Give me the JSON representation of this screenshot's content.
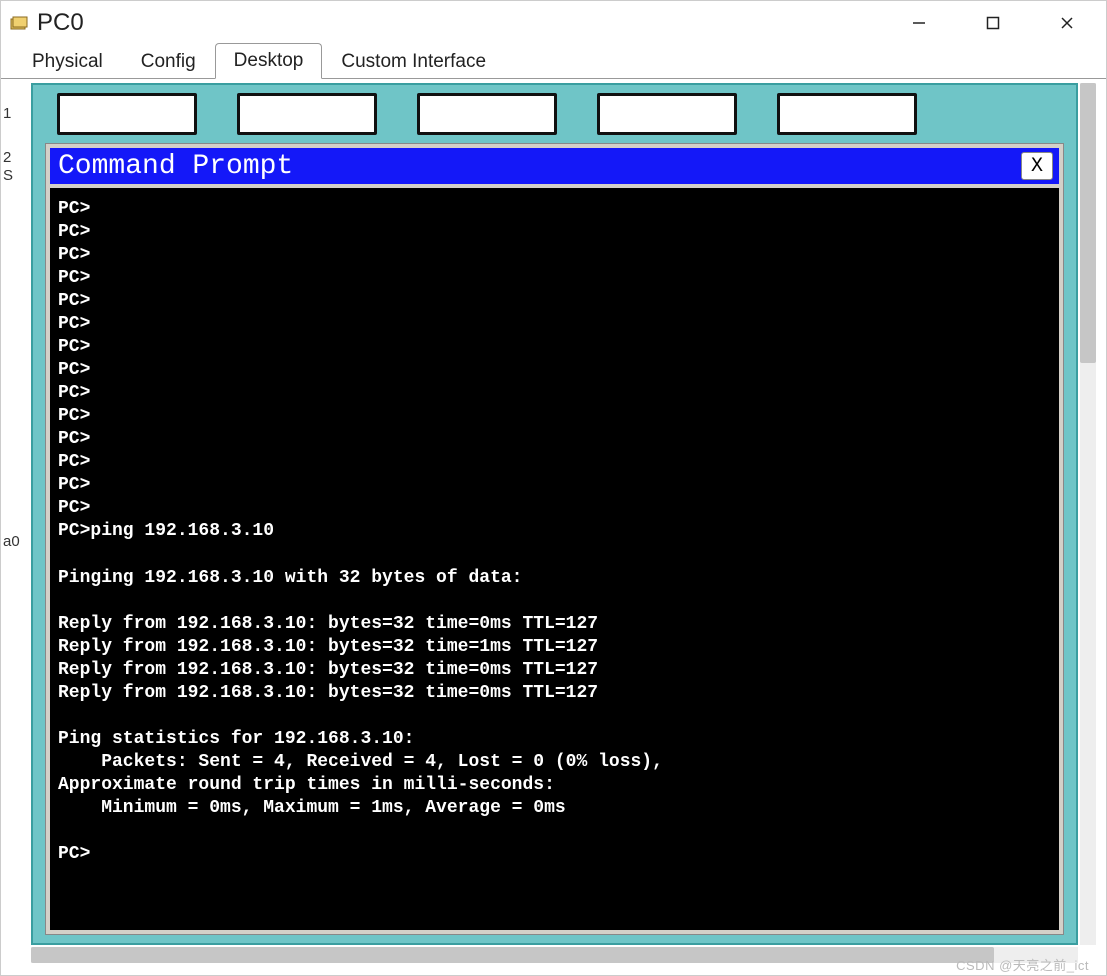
{
  "window": {
    "title": "PC0"
  },
  "tabs": [
    {
      "label": "Physical",
      "active": false
    },
    {
      "label": "Config",
      "active": false
    },
    {
      "label": "Desktop",
      "active": true
    },
    {
      "label": "Custom Interface",
      "active": false
    }
  ],
  "left_bg_labels": {
    "a": "1",
    "b": "2",
    "c": "S",
    "d": "a0"
  },
  "command_prompt": {
    "title": "Command Prompt",
    "close_label": "X",
    "lines": [
      "PC>",
      "PC>",
      "PC>",
      "PC>",
      "PC>",
      "PC>",
      "PC>",
      "PC>",
      "PC>",
      "PC>",
      "PC>",
      "PC>",
      "PC>",
      "PC>",
      "PC>ping 192.168.3.10",
      "",
      "Pinging 192.168.3.10 with 32 bytes of data:",
      "",
      "Reply from 192.168.3.10: bytes=32 time=0ms TTL=127",
      "Reply from 192.168.3.10: bytes=32 time=1ms TTL=127",
      "Reply from 192.168.3.10: bytes=32 time=0ms TTL=127",
      "Reply from 192.168.3.10: bytes=32 time=0ms TTL=127",
      "",
      "Ping statistics for 192.168.3.10:",
      "    Packets: Sent = 4, Received = 4, Lost = 0 (0% loss),",
      "Approximate round trip times in milli-seconds:",
      "    Minimum = 0ms, Maximum = 1ms, Average = 0ms",
      "",
      "PC>"
    ]
  },
  "watermark": "CSDN @天亮之前_ict"
}
